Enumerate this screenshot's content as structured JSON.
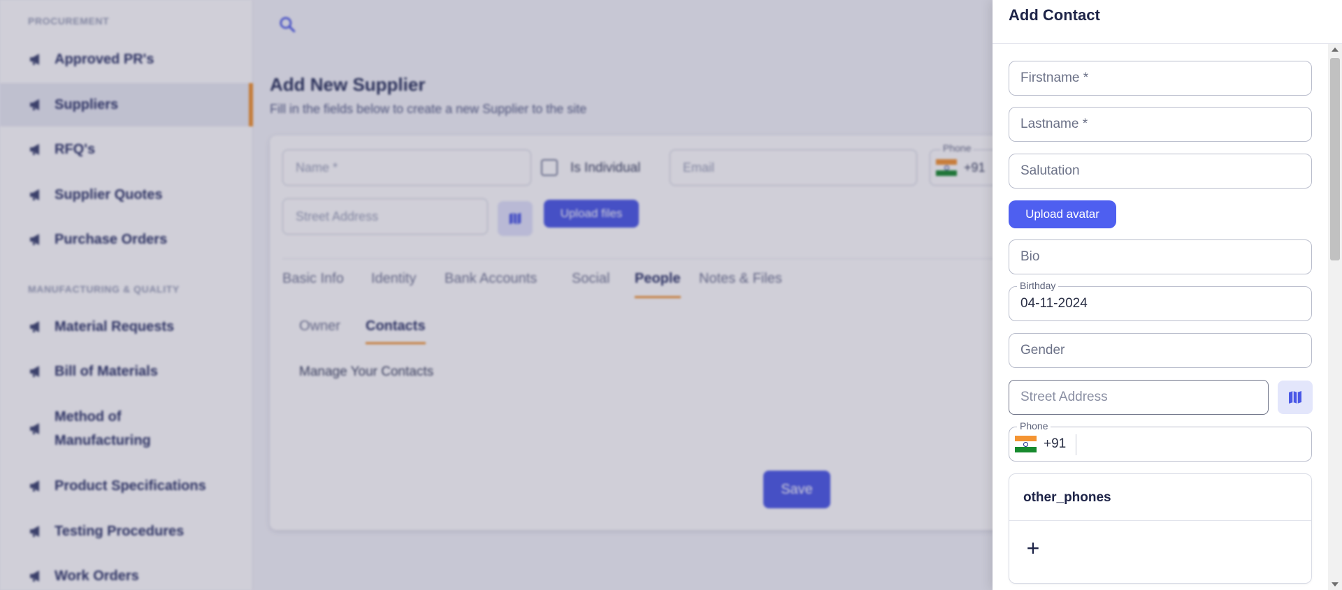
{
  "sidebar": {
    "procurement_label": "PROCUREMENT",
    "procurement_items": [
      {
        "label": "Approved PR's"
      },
      {
        "label": "Suppliers",
        "active": true
      },
      {
        "label": "RFQ's"
      },
      {
        "label": "Supplier Quotes"
      },
      {
        "label": "Purchase Orders"
      }
    ],
    "mq_label": "MANUFACTURING & QUALITY",
    "mq_items": [
      {
        "label": "Material Requests"
      },
      {
        "label": "Bill of Materials"
      },
      {
        "label": "Method of Manufacturing"
      },
      {
        "label": "Product Specifications"
      },
      {
        "label": "Testing Procedures"
      },
      {
        "label": "Work Orders"
      }
    ],
    "item_icon": "megaphone-icon"
  },
  "header": {
    "search_icon": "search-icon"
  },
  "page": {
    "title": "Add New Supplier",
    "subtitle": "Fill in the fields below to create a new Supplier to the site"
  },
  "supplier_form": {
    "name_placeholder": "Name *",
    "is_individual_label": "Is Individual",
    "email_placeholder": "Email",
    "phone_label": "Phone",
    "phone_code": "+91",
    "street_placeholder": "Street Address",
    "upload_files_label": "Upload files",
    "tabs": [
      "Basic Info",
      "Identity",
      "Bank Accounts",
      "Social",
      "People",
      "Notes & Files"
    ],
    "active_tab": "People",
    "subtabs": [
      "Owner",
      "Contacts"
    ],
    "active_subtab": "Contacts",
    "manage_text": "Manage Your Contacts",
    "save_label": "Save"
  },
  "drawer": {
    "title": "Add Contact",
    "firstname_placeholder": "Firstname *",
    "lastname_placeholder": "Lastname *",
    "salutation_placeholder": "Salutation",
    "upload_avatar_label": "Upload avatar",
    "bio_placeholder": "Bio",
    "birthday_label": "Birthday",
    "birthday_value": "04-11-2024",
    "gender_placeholder": "Gender",
    "street_placeholder": "Street Address",
    "phone_label": "Phone",
    "phone_code": "+91",
    "other_phones_title": "other_phones",
    "add_symbol": "+"
  },
  "colors": {
    "accent": "#4e5ff0",
    "active_tab_underline": "#f0922e",
    "title_text": "#1d2347"
  }
}
